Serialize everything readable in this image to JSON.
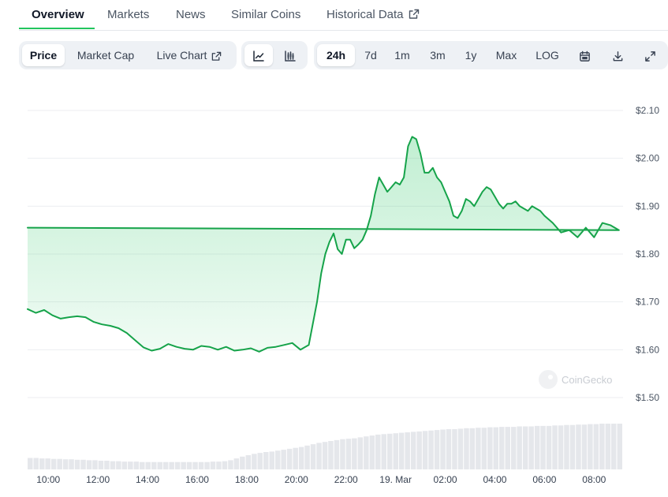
{
  "tabs": {
    "overview": "Overview",
    "markets": "Markets",
    "news": "News",
    "similar": "Similar Coins",
    "historical": "Historical Data"
  },
  "toolbar": {
    "price": "Price",
    "market_cap": "Market Cap",
    "live_chart": "Live Chart",
    "ranges": [
      "24h",
      "7d",
      "1m",
      "3m",
      "1y",
      "Max"
    ],
    "selected_range": "24h",
    "log": "LOG"
  },
  "watermark": "CoinGecko",
  "colors": {
    "line": "#16a34a",
    "volume": "#e5e7eb",
    "accent": "#22c55e"
  },
  "chart_data": {
    "type": "area",
    "xlabel": "",
    "ylabel": "",
    "ylim": [
      1.5,
      2.1
    ],
    "yticks": [
      "$2.10",
      "$2.00",
      "$1.90",
      "$1.80",
      "$1.70",
      "$1.60",
      "$1.50"
    ],
    "xticks": [
      "10:00",
      "12:00",
      "14:00",
      "16:00",
      "18:00",
      "20:00",
      "22:00",
      "19. Mar",
      "02:00",
      "04:00",
      "06:00",
      "08:00"
    ],
    "grid": true,
    "series": [
      {
        "x": [
          "09:10",
          "09:30",
          "09:50",
          "10:10",
          "10:30",
          "10:50",
          "11:10",
          "11:30",
          "11:50",
          "12:10",
          "12:30",
          "12:50",
          "13:10",
          "13:30",
          "13:50",
          "14:10",
          "14:30",
          "14:50",
          "15:10",
          "15:30",
          "15:50",
          "16:10",
          "16:30",
          "16:50",
          "17:10",
          "17:30",
          "17:50",
          "18:10",
          "18:30",
          "18:50",
          "19:10",
          "19:30",
          "19:50",
          "20:10",
          "20:30",
          "20:50",
          "21:00",
          "21:10",
          "21:20",
          "21:30",
          "21:40",
          "21:50",
          "22:00",
          "22:10",
          "22:20",
          "22:30",
          "22:40",
          "22:50",
          "23:00",
          "23:10",
          "23:20",
          "23:30",
          "23:40",
          "23:50",
          "00:00",
          "00:10",
          "00:20",
          "00:30",
          "00:40",
          "00:50",
          "01:00",
          "01:10",
          "01:20",
          "01:30",
          "01:40",
          "01:50",
          "02:00",
          "02:10",
          "02:20",
          "02:30",
          "02:40",
          "02:50",
          "03:00",
          "03:10",
          "03:20",
          "03:30",
          "03:40",
          "03:50",
          "04:00",
          "04:10",
          "04:20",
          "04:30",
          "04:40",
          "04:50",
          "05:00",
          "05:10",
          "05:20",
          "05:30",
          "05:40",
          "05:50",
          "06:00",
          "06:20",
          "06:40",
          "07:00",
          "07:20",
          "07:40",
          "08:00",
          "08:20",
          "08:40",
          "09:00",
          "09:10"
        ],
        "values": [
          1.685,
          1.677,
          1.683,
          1.672,
          1.665,
          1.668,
          1.67,
          1.668,
          1.658,
          1.653,
          1.65,
          1.645,
          1.635,
          1.62,
          1.605,
          1.598,
          1.602,
          1.612,
          1.606,
          1.602,
          1.6,
          1.608,
          1.606,
          1.6,
          1.606,
          1.598,
          1.6,
          1.603,
          1.596,
          1.604,
          1.606,
          1.61,
          1.614,
          1.6,
          1.61,
          1.7,
          1.76,
          1.8,
          1.825,
          1.843,
          1.81,
          1.8,
          1.83,
          1.83,
          1.812,
          1.82,
          1.83,
          1.85,
          1.88,
          1.925,
          1.96,
          1.945,
          1.93,
          1.94,
          1.95,
          1.945,
          1.96,
          2.025,
          2.045,
          2.04,
          2.01,
          1.97,
          1.97,
          1.98,
          1.96,
          1.95,
          1.93,
          1.91,
          1.88,
          1.875,
          1.89,
          1.915,
          1.91,
          1.9,
          1.915,
          1.93,
          1.94,
          1.935,
          1.92,
          1.905,
          1.895,
          1.905,
          1.905,
          1.91,
          1.9,
          1.895,
          1.89,
          1.9,
          1.895,
          1.89,
          1.88,
          1.865,
          1.845,
          1.85,
          1.835,
          1.855,
          1.835,
          1.865,
          1.86,
          1.85,
          1.855
        ]
      }
    ],
    "volume": [
      0.25,
      0.25,
      0.24,
      0.24,
      0.23,
      0.23,
      0.22,
      0.22,
      0.21,
      0.21,
      0.2,
      0.2,
      0.19,
      0.19,
      0.18,
      0.18,
      0.17,
      0.17,
      0.17,
      0.16,
      0.16,
      0.16,
      0.16,
      0.16,
      0.16,
      0.16,
      0.16,
      0.16,
      0.16,
      0.16,
      0.16,
      0.17,
      0.17,
      0.18,
      0.2,
      0.24,
      0.28,
      0.31,
      0.34,
      0.36,
      0.38,
      0.39,
      0.41,
      0.43,
      0.45,
      0.47,
      0.49,
      0.52,
      0.55,
      0.58,
      0.6,
      0.62,
      0.64,
      0.66,
      0.67,
      0.68,
      0.7,
      0.72,
      0.74,
      0.76,
      0.77,
      0.78,
      0.79,
      0.8,
      0.81,
      0.82,
      0.83,
      0.84,
      0.85,
      0.86,
      0.87,
      0.88,
      0.88,
      0.89,
      0.9,
      0.9,
      0.91,
      0.91,
      0.92,
      0.92,
      0.93,
      0.93,
      0.93,
      0.94,
      0.94,
      0.94,
      0.95,
      0.95,
      0.95,
      0.96,
      0.96,
      0.97,
      0.97,
      0.98,
      0.98,
      0.99,
      0.99,
      1.0,
      1.0,
      1.0,
      1.0
    ]
  }
}
